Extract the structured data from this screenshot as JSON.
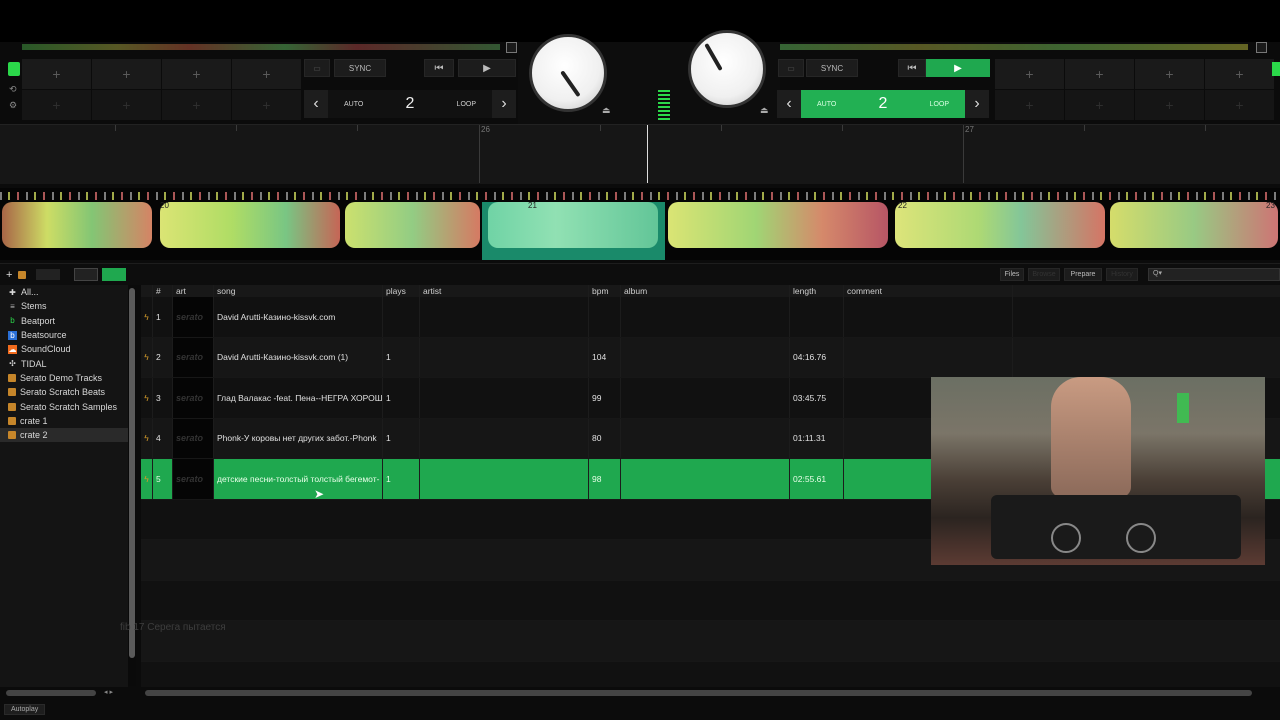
{
  "deck_left": {
    "sync_label": "SYNC",
    "auto_label": "AUTO",
    "loop_value": "2",
    "loop_label": "LOOP",
    "cue_plus": [
      "+",
      "+",
      "+",
      "+"
    ],
    "cue_plus_dim": [
      "+",
      "+",
      "+",
      "+"
    ]
  },
  "deck_right": {
    "sync_label": "SYNC",
    "auto_label": "AUTO",
    "loop_value": "2",
    "loop_label": "LOOP",
    "cue_plus": [
      "+",
      "+",
      "+",
      "+"
    ],
    "cue_plus_dim": [
      "+",
      "+",
      "+",
      "+"
    ]
  },
  "beatgrid": {
    "labels": [
      "26",
      "27"
    ]
  },
  "waveform": {
    "labels": [
      "20",
      "21",
      "22",
      "23"
    ]
  },
  "library_toolbar": {
    "files_label": "Files",
    "browse_label": "Browse",
    "prepare_label": "Prepare",
    "history_label": "History",
    "search_placeholder": "Q▾"
  },
  "sidebar": {
    "items": [
      {
        "label": "All...",
        "icon": "all-icon"
      },
      {
        "label": "Stems",
        "icon": "stems-icon"
      },
      {
        "label": "Beatport",
        "icon": "beatport-icon"
      },
      {
        "label": "Beatsource",
        "icon": "beatsource-icon"
      },
      {
        "label": "SoundCloud",
        "icon": "soundcloud-icon"
      },
      {
        "label": "TIDAL",
        "icon": "tidal-icon"
      },
      {
        "label": "Serato Demo Tracks",
        "icon": "crate-icon"
      },
      {
        "label": "Serato Scratch Beats",
        "icon": "crate-icon"
      },
      {
        "label": "Serato Scratch Samples",
        "icon": "crate-icon"
      },
      {
        "label": "crate 1",
        "icon": "crate-icon"
      },
      {
        "label": "crate 2",
        "icon": "crate-icon"
      }
    ],
    "selected_index": 10
  },
  "table": {
    "columns": {
      "num": "#",
      "art": "art",
      "song": "song",
      "plays": "plays",
      "artist": "artist",
      "bpm": "bpm",
      "album": "album",
      "length": "length",
      "comment": "comment"
    },
    "art_placeholder": "serato",
    "rows": [
      {
        "num": "1",
        "song": "David Arutti-Казино-kissvk.com",
        "plays": "",
        "artist": "",
        "bpm": "",
        "album": "",
        "length": "",
        "comment": ""
      },
      {
        "num": "2",
        "song": "David Arutti-Казино-kissvk.com (1)",
        "plays": "1",
        "artist": "",
        "bpm": "104",
        "album": "",
        "length": "04:16.76",
        "comment": ""
      },
      {
        "num": "3",
        "song": "Глад Валакас -feat. Пена--НЕГРА ХОРОШ",
        "plays": "1",
        "artist": "",
        "bpm": "99",
        "album": "",
        "length": "03:45.75",
        "comment": ""
      },
      {
        "num": "4",
        "song": "Phonk-У коровы нет других забот.-Phonk",
        "plays": "1",
        "artist": "",
        "bpm": "80",
        "album": "",
        "length": "01:11.31",
        "comment": ""
      },
      {
        "num": "5",
        "song": "детские песни-толстый толстый бегемот-",
        "plays": "1",
        "artist": "",
        "bpm": "98",
        "album": "",
        "length": "02:55.61",
        "comment": ""
      }
    ],
    "selected_index": 4
  },
  "overlay": {
    "chat_text": "fib 17  Серега пытается"
  },
  "footer": {
    "autoplay_label": "Autoplay"
  },
  "colors": {
    "accent_green": "#1fa84f",
    "crate_orange": "#c6862a"
  }
}
